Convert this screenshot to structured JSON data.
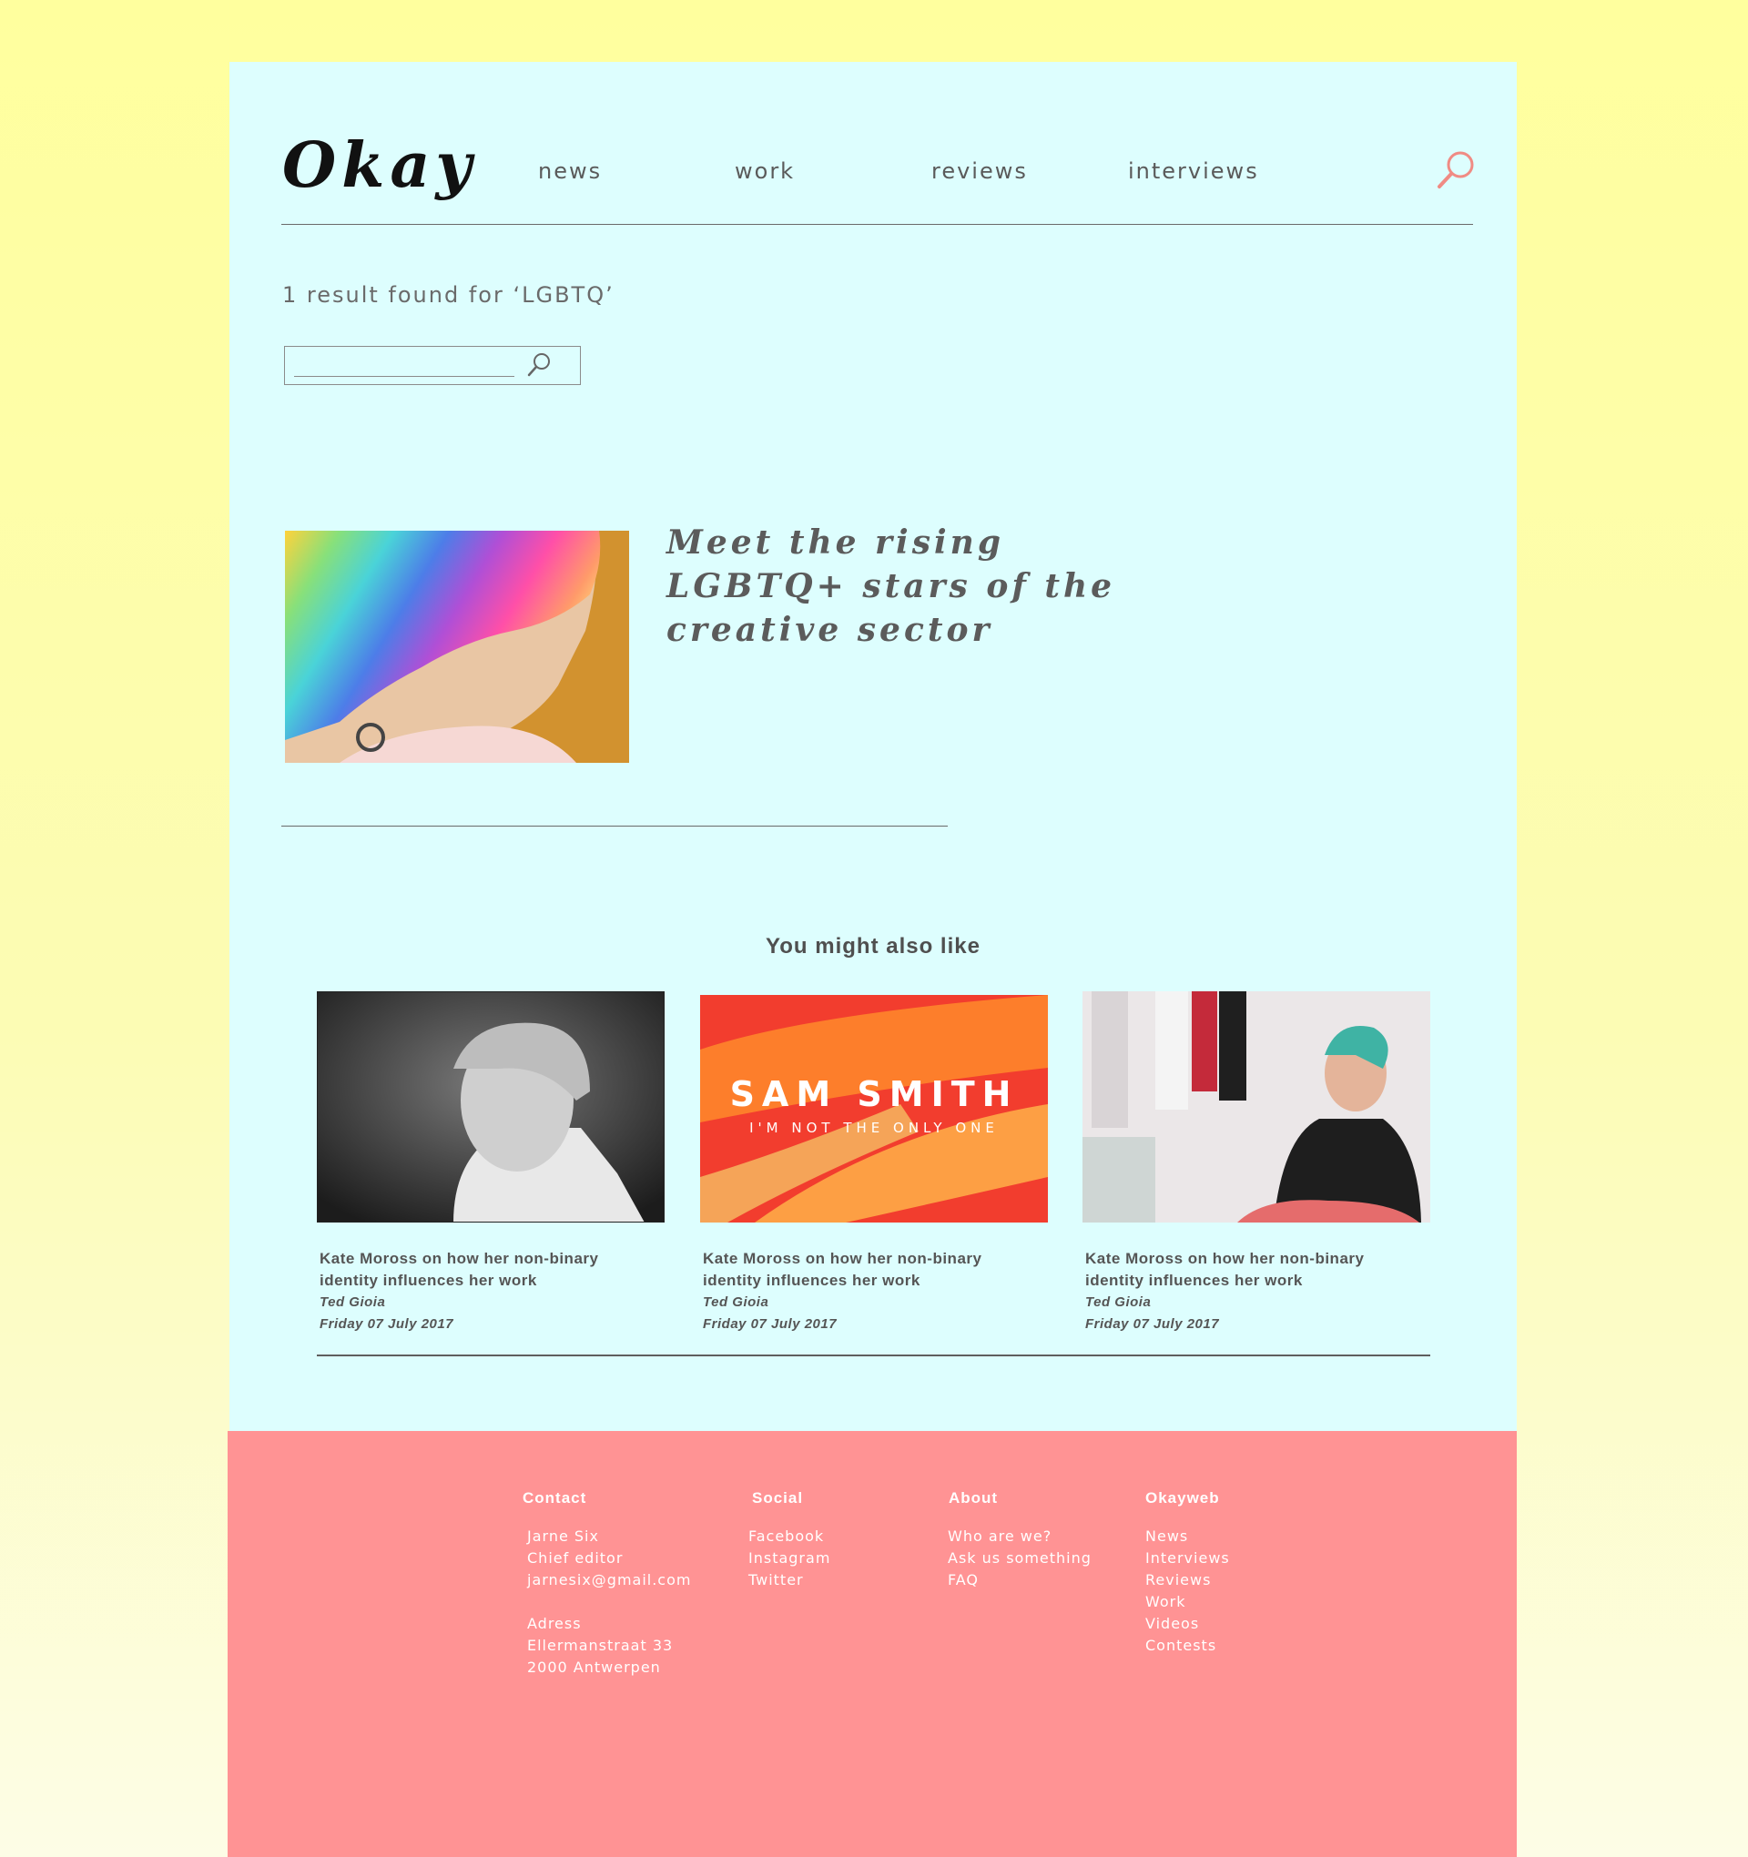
{
  "brand": {
    "logo": "Okay"
  },
  "nav": {
    "items": [
      "news",
      "work",
      "reviews",
      "interviews"
    ]
  },
  "search": {
    "result_text": "1 result found for ‘LGBTQ’",
    "placeholder": "",
    "value": ""
  },
  "result": {
    "title_lines": [
      "Meet the rising",
      "LGBTQ+ stars of the",
      "creative sector"
    ]
  },
  "also_like": {
    "heading": "You might also like",
    "cards": [
      {
        "title_lines": [
          "Kate Moross on how her non-binary",
          "identity influences her work"
        ],
        "author": "Ted Gioia",
        "date": "Friday 07 July 2017"
      },
      {
        "title_lines": [
          "Kate Moross on how her non-binary",
          "identity influences her work"
        ],
        "author": "Ted Gioia",
        "date": "Friday 07 July 2017",
        "image_text": {
          "artist": "SAM SMITH",
          "song": "I'M NOT THE ONLY ONE"
        }
      },
      {
        "title_lines": [
          "Kate Moross on how her non-binary",
          "identity influences her work"
        ],
        "author": "Ted Gioia",
        "date": "Friday 07 July 2017"
      }
    ]
  },
  "footer": {
    "contact": {
      "heading": "Contact",
      "lines": [
        "Jarne Six",
        "Chief editor",
        "jarnesix@gmail.com"
      ],
      "address_lines": [
        "Adress",
        "Ellermanstraat 33",
        "2000 Antwerpen"
      ]
    },
    "social": {
      "heading": "Social",
      "links": [
        "Facebook",
        "Instagram",
        "Twitter"
      ]
    },
    "about": {
      "heading": "About",
      "links": [
        "Who are we?",
        "Ask us something",
        "FAQ"
      ]
    },
    "okayweb": {
      "heading": "Okayweb",
      "links": [
        "News",
        "Interviews",
        "Reviews",
        "Work",
        "Videos",
        "Contests"
      ]
    }
  },
  "colors": {
    "page_bg": "#ddfefe",
    "footer_bg": "#ff9394",
    "accent_icon": "#f08b84",
    "text": "#5a5a5a"
  }
}
